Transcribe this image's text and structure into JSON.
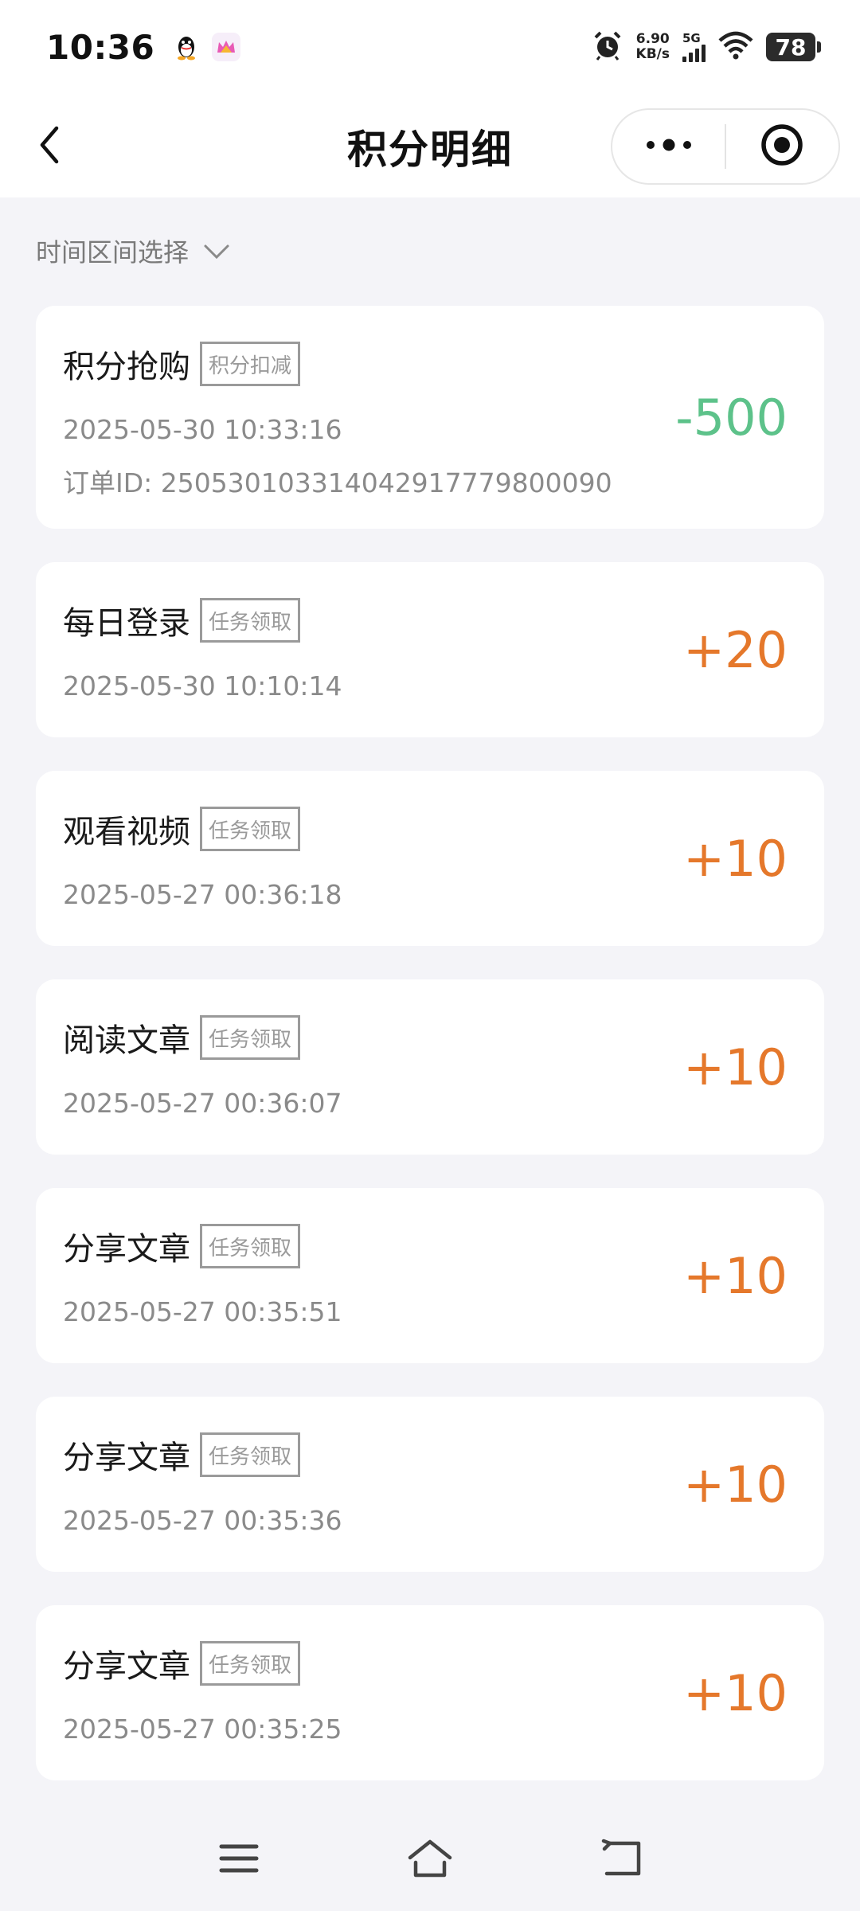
{
  "status_bar": {
    "time": "10:36",
    "net_speed_value": "6.90",
    "net_speed_unit": "KB/s",
    "network": "5G",
    "battery": "78"
  },
  "nav": {
    "title": "积分明细",
    "more_icon": "more-dots-icon",
    "close_icon": "target-circle-icon"
  },
  "filter": {
    "label": "时间区间选择"
  },
  "records": [
    {
      "title": "积分抢购",
      "tag": "积分扣减",
      "time": "2025-05-30 10:33:16",
      "order": "订单ID: 25053010331404291777980009​0",
      "amount": "-500",
      "type": "negative"
    },
    {
      "title": "每日登录",
      "tag": "任务领取",
      "time": "2025-05-30 10:10:14",
      "amount": "+20",
      "type": "positive"
    },
    {
      "title": "观看视频",
      "tag": "任务领取",
      "time": "2025-05-27 00:36:18",
      "amount": "+10",
      "type": "positive"
    },
    {
      "title": "阅读文章",
      "tag": "任务领取",
      "time": "2025-05-27 00:36:07",
      "amount": "+10",
      "type": "positive"
    },
    {
      "title": "分享文章",
      "tag": "任务领取",
      "time": "2025-05-27 00:35:51",
      "amount": "+10",
      "type": "positive"
    },
    {
      "title": "分享文章",
      "tag": "任务领取",
      "time": "2025-05-27 00:35:36",
      "amount": "+10",
      "type": "positive"
    },
    {
      "title": "分享文章",
      "tag": "任务领取",
      "time": "2025-05-27 00:35:25",
      "amount": "+10",
      "type": "positive"
    }
  ],
  "colors": {
    "negative": "#5dc28a",
    "positive": "#e5782b",
    "background": "#f4f4f8"
  }
}
